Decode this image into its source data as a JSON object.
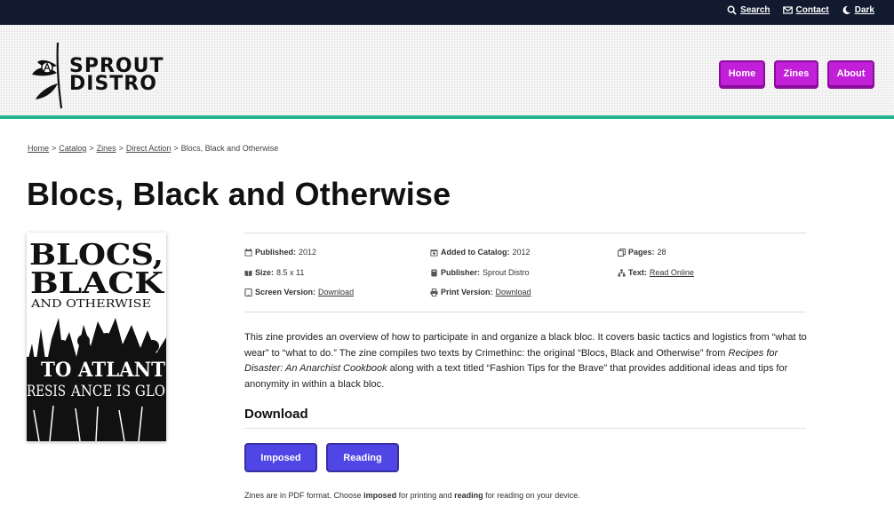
{
  "topnav": {
    "search": "Search",
    "contact": "Contact",
    "dark": "Dark"
  },
  "logo": {
    "line1": "SPROUT",
    "line2": "DISTRO"
  },
  "mainnav": [
    "Home",
    "Zines",
    "About"
  ],
  "breadcrumb": {
    "home": "Home",
    "catalog": "Catalog",
    "zines": "Zines",
    "direct_action": "Direct Action",
    "current": "Blocs, Black and Otherwise"
  },
  "title": "Blocs, Black and Otherwise",
  "cover": {
    "line1": "BLOCS,",
    "line2": "BLACK",
    "line3": "AND OTHERWISE",
    "banner1": "TO ATLANT",
    "banner2": "RESIS",
    "banner3": "ANCE IS GLO"
  },
  "meta": {
    "published_label": "Published:",
    "published_value": "2012",
    "added_label": "Added to Catalog:",
    "added_value": "2012",
    "pages_label": "Pages:",
    "pages_value": "28",
    "size_label": "Size:",
    "size_value": "8.5 x 11",
    "publisher_label": "Publisher:",
    "publisher_value": "Sprout Distro",
    "text_label": "Text:",
    "text_value": "Read Online",
    "screen_label": "Screen Version:",
    "screen_value": "Download",
    "print_label": "Print Version:",
    "print_value": "Download"
  },
  "description": {
    "part1": "This zine provides an overview of how to participate in and organize a black bloc. It covers basic tactics and logistics from “what to wear” to “what to do.” The zine compiles two texts by Crimethinc: the original “Blocs, Black and Otherwise” from ",
    "italic": "Recipes for Disaster: An Anarchist Cookbook",
    "part2": " along with a text titled “Fashion Tips for the Brave” that provides additional ideas and tips for anonymity in within a black bloc."
  },
  "download": {
    "heading": "Download",
    "imposed": "Imposed",
    "reading": "Reading",
    "note_prefix": "Zines are in PDF format. Choose ",
    "note_imposed": "imposed",
    "note_mid": " for printing and ",
    "note_reading": "reading",
    "note_suffix": " for reading on your device."
  },
  "colors": {
    "topbar": "#111a2f",
    "accent_green": "#24b58e",
    "nav_magenta": "#c21fd8",
    "button_indigo": "#4f46e5"
  }
}
